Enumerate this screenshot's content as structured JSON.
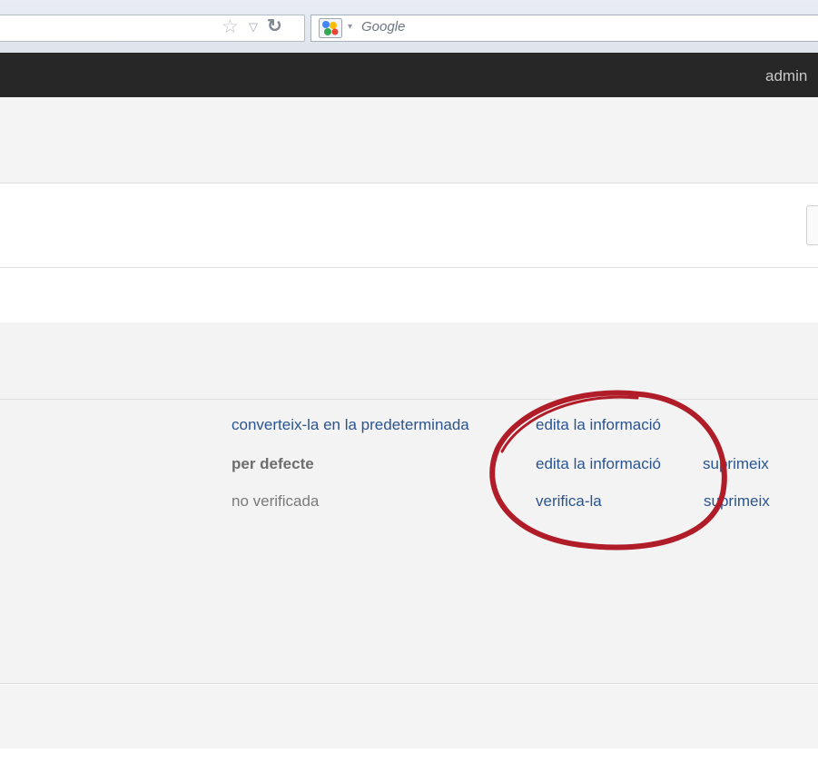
{
  "browser": {
    "search_placeholder": "Google",
    "icons": [
      "star-icon",
      "dropdown-icon",
      "reload-icon",
      "search-engine-icon"
    ]
  },
  "header": {
    "user_link": "admin"
  },
  "table": {
    "rows": [
      {
        "status": "converteix-la en la predeterminada",
        "status_type": "link",
        "edit": "edita la informació",
        "delete": ""
      },
      {
        "status": "per defecte",
        "status_type": "bold",
        "edit": "edita la informació",
        "delete": "suprimeix"
      },
      {
        "status": "no verificada",
        "status_type": "muted",
        "edit": "verifica-la",
        "delete": "suprimeix"
      }
    ]
  },
  "colors": {
    "header_bg": "#272727",
    "link": "#2a5490",
    "annotation": "#b01c28"
  }
}
